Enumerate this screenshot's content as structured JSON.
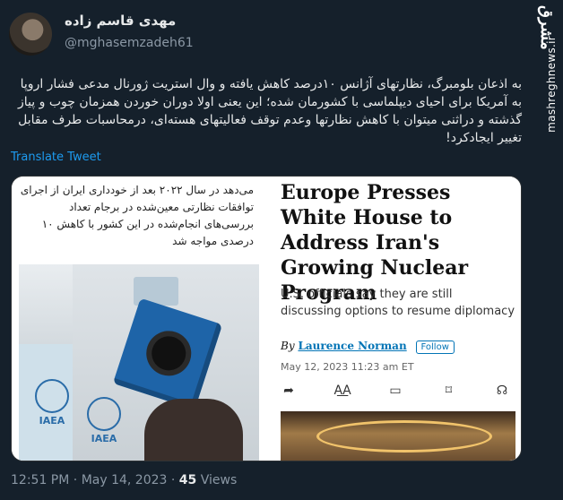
{
  "brand": {
    "logo_text": "مشرق",
    "site_url": "mashreghnews.ir"
  },
  "author": {
    "name": "مهدی قاسم زاده",
    "handle": "@mghasemzadeh61"
  },
  "tweet": {
    "text": "به اذعان بلومبرگ، نظارتهای آژانس ۱۰درصد کاهش یافته و وال استریت ژورنال مدعی فشار اروپا به آمریکا برای احیای دیپلماسی با کشورمان شده؛ این یعنی اولا دوران خوردن همزمان چوب و پیاز گذشته و دراثنی میتوان با کاهش نظارتها وعدم توقف فعالیتهای هسته‌ای، درمحاسبات طرف مقابل تغییر ایجادکرد!",
    "translate_label": "Translate Tweet"
  },
  "media": {
    "left": {
      "caption": "می‌دهد در سال ۲۰۲۲ بعد از خودداری ایران از اجرای توافقات نظارتی معین‌شده در برجام تعداد بررسی‌های انجام‌شده در این کشور با کاهش ۱۰ درصدی مواجه شد",
      "logo1": "IAEA",
      "logo2": "IAEA"
    },
    "right": {
      "headline": "Europe Presses White House to Address Iran's Growing Nuclear Program",
      "subhead": "U.S. officials say they are still discussing options to resume diplomacy",
      "byline_prefix": "By",
      "author": "Laurence Norman",
      "follow_label": "Follow",
      "dateline": "May 12, 2023 11:23 am ET",
      "icons": [
        "share-icon",
        "text-size-icon",
        "comment-icon",
        "bookmark-icon",
        "listen-icon"
      ]
    }
  },
  "footer": {
    "time": "12:51 PM",
    "separator": "·",
    "date": "May 14, 2023",
    "views_count": "45",
    "views_label": "Views"
  }
}
